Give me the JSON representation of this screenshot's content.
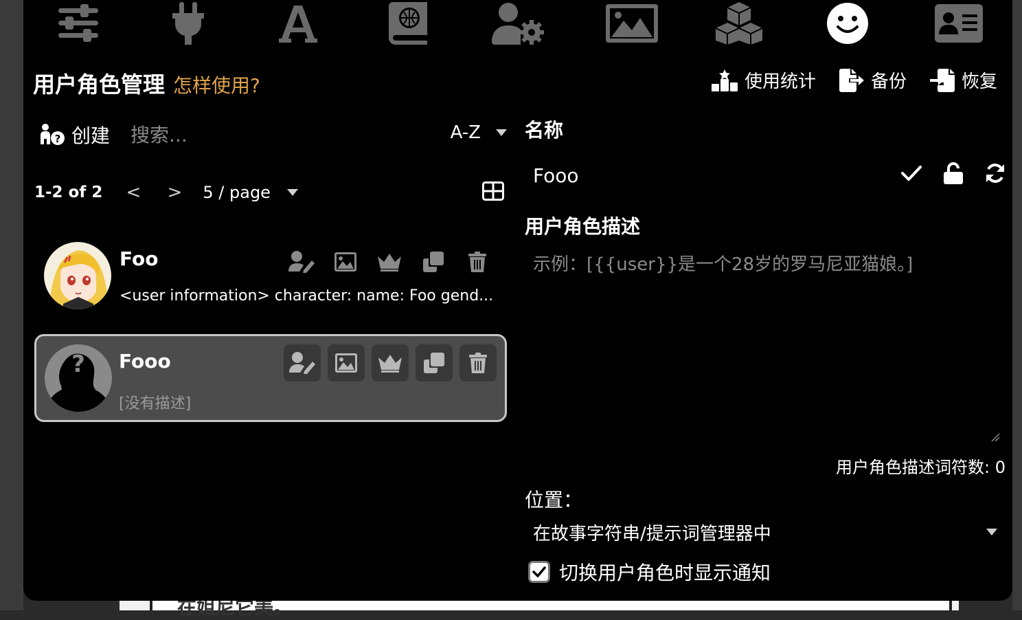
{
  "topnav": {
    "items": [
      {
        "icon": "sliders-icon"
      },
      {
        "icon": "plug-icon"
      },
      {
        "icon": "font-icon"
      },
      {
        "icon": "book-globe-icon"
      },
      {
        "icon": "user-gear-icon"
      },
      {
        "icon": "image-icon"
      },
      {
        "icon": "cubes-icon"
      },
      {
        "icon": "smiley-icon",
        "active": true
      },
      {
        "icon": "id-card-icon"
      }
    ]
  },
  "panel": {
    "title": "用户角色管理",
    "help_link": "怎样使用?",
    "actions": {
      "stats_label": "使用统计",
      "backup_label": "备份",
      "restore_label": "恢复"
    }
  },
  "list": {
    "create_label": "创建",
    "search_placeholder": "搜索...",
    "sort_value": "A-Z",
    "pager": {
      "count": "1-2 of 2",
      "prev": "<",
      "next": ">",
      "per_page": "5 / page"
    },
    "personas": [
      {
        "name": "Foo",
        "description": "<user information> character: name: Foo gend..."
      },
      {
        "name": "Fooo",
        "description": "[没有描述]",
        "selected": true
      }
    ]
  },
  "editor": {
    "name_label": "名称",
    "name_value": "Fooo",
    "description_label": "用户角色描述",
    "description_placeholder": "示例：[{{user}}是一个28岁的罗马尼亚猫娘。]",
    "word_count": "用户角色描述词符数: 0",
    "position_label": "位置：",
    "position_value": "在故事字符串/提示词管理器中",
    "notify_label": "切换用户角色时显示通知",
    "notify_checked": true
  },
  "background": {
    "ghost_text": "在姐尼它美。"
  }
}
